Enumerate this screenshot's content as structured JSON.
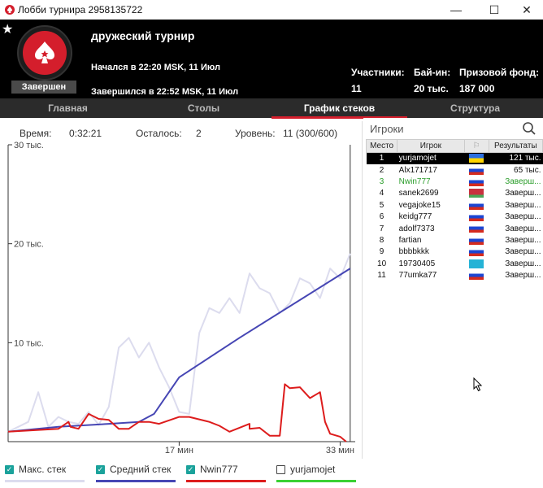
{
  "window": {
    "title": "Лобби турнира 2958135722",
    "minimize": "—",
    "maximize": "☐",
    "close": "✕"
  },
  "header": {
    "tournament_name": "дружеский турнир",
    "status": "Завершен",
    "started": "Начался в 22:20 MSK, 11 Июл",
    "ended": "Завершился в 22:52 MSK, 11 Июл",
    "participants_label": "Участники:",
    "participants_value": "11",
    "buyin_label": "Бай-ин:",
    "buyin_value": "20 тыс.",
    "prize_label": "Призовой фонд:",
    "prize_value": "187 000"
  },
  "tabs": [
    {
      "label": "Главная",
      "active": false
    },
    {
      "label": "Столы",
      "active": false
    },
    {
      "label": "График стеков",
      "active": true
    },
    {
      "label": "Структура",
      "active": false
    }
  ],
  "stats": {
    "time_label": "Время:",
    "time_value": "0:32:21",
    "left_label": "Осталось:",
    "left_value": "2",
    "level_label": "Уровень:",
    "level_value": "11 (300/600)"
  },
  "players": {
    "title": "Игроки",
    "columns": [
      "Место",
      "Игрок",
      "",
      "Результаты"
    ],
    "rows": [
      {
        "place": "1",
        "name": "yurjamojet",
        "flag": "ukraine",
        "result": "121 тыс."
      },
      {
        "place": "2",
        "name": "Alx171717",
        "flag": "russia",
        "result": "65 тыс."
      },
      {
        "place": "3",
        "name": "Nwin777",
        "flag": "russia",
        "result": "Заверш..."
      },
      {
        "place": "4",
        "name": "sanek2699",
        "flag": "belarus",
        "result": "Заверш..."
      },
      {
        "place": "5",
        "name": "vegajoke15",
        "flag": "russia",
        "result": "Заверш..."
      },
      {
        "place": "6",
        "name": "keidg777",
        "flag": "russia",
        "result": "Заверш..."
      },
      {
        "place": "7",
        "name": "adolf7373",
        "flag": "russia",
        "result": "Заверш..."
      },
      {
        "place": "8",
        "name": "fartian",
        "flag": "russia",
        "result": "Заверш..."
      },
      {
        "place": "9",
        "name": "bbbbkkk",
        "flag": "russia",
        "result": "Заверш..."
      },
      {
        "place": "10",
        "name": "19730405",
        "flag": "kazakhstan",
        "result": "Заверш..."
      },
      {
        "place": "11",
        "name": "77umka77",
        "flag": "russia",
        "result": "Заверш..."
      }
    ]
  },
  "chart_data": {
    "type": "line",
    "ytick_labels": [
      "30 тыс.",
      "20 тыс.",
      "10 тыс."
    ],
    "yticks": [
      30000,
      20000,
      10000
    ],
    "ylim": [
      0,
      30000
    ],
    "xtick_labels": [
      "17 мин",
      "33 мин"
    ],
    "xticks": [
      17,
      33
    ],
    "xlim": [
      0,
      34.5
    ],
    "series": [
      {
        "name": "Макс. стек",
        "color": "#dcdcee",
        "checked": true,
        "points": [
          [
            0,
            1000
          ],
          [
            1,
            1500
          ],
          [
            2,
            2000
          ],
          [
            3,
            5000
          ],
          [
            4,
            1500
          ],
          [
            5,
            2500
          ],
          [
            6,
            2000
          ],
          [
            7,
            1800
          ],
          [
            8,
            3000
          ],
          [
            9,
            1700
          ],
          [
            10,
            3500
          ],
          [
            11,
            9500
          ],
          [
            12,
            10500
          ],
          [
            13,
            8500
          ],
          [
            14,
            10000
          ],
          [
            15,
            7500
          ],
          [
            16,
            5500
          ],
          [
            17,
            3000
          ],
          [
            18,
            2800
          ],
          [
            19,
            11000
          ],
          [
            20,
            13500
          ],
          [
            21,
            13000
          ],
          [
            22,
            14500
          ],
          [
            23,
            13000
          ],
          [
            24,
            17000
          ],
          [
            25,
            15500
          ],
          [
            26,
            15000
          ],
          [
            27,
            13000
          ],
          [
            28,
            14000
          ],
          [
            29,
            16500
          ],
          [
            30,
            16000
          ],
          [
            31,
            14500
          ],
          [
            32,
            17500
          ],
          [
            33,
            16500
          ],
          [
            34,
            19000
          ]
        ]
      },
      {
        "name": "Средний стек",
        "color": "#4646b4",
        "checked": true,
        "points": [
          [
            0,
            1000
          ],
          [
            5,
            1500
          ],
          [
            10,
            1800
          ],
          [
            13,
            2000
          ],
          [
            14.5,
            2800
          ],
          [
            17,
            6500
          ],
          [
            23,
            10500
          ],
          [
            34,
            17500
          ]
        ]
      },
      {
        "name": "Nwin777",
        "color": "#dd1c1c",
        "checked": true,
        "points": [
          [
            0,
            1000
          ],
          [
            5,
            1300
          ],
          [
            6,
            2000
          ],
          [
            6.2,
            1500
          ],
          [
            7,
            1300
          ],
          [
            8,
            2800
          ],
          [
            9,
            2300
          ],
          [
            10,
            2200
          ],
          [
            11,
            1300
          ],
          [
            12,
            1300
          ],
          [
            13,
            2000
          ],
          [
            14,
            2000
          ],
          [
            15,
            1800
          ],
          [
            17,
            2500
          ],
          [
            18,
            2500
          ],
          [
            20,
            2000
          ],
          [
            21,
            1600
          ],
          [
            22,
            1000
          ],
          [
            24,
            1800
          ],
          [
            24,
            1300
          ],
          [
            25,
            1400
          ],
          [
            26,
            600
          ],
          [
            27,
            600
          ],
          [
            27.5,
            5800
          ],
          [
            28,
            5400
          ],
          [
            29,
            5500
          ],
          [
            30,
            4400
          ],
          [
            31,
            5000
          ],
          [
            31.5,
            2000
          ],
          [
            32,
            800
          ],
          [
            33,
            500
          ],
          [
            33.6,
            0
          ]
        ]
      },
      {
        "name": "yurjamojet",
        "color": "#3ad134",
        "checked": false,
        "points": []
      }
    ],
    "endline_x": 34,
    "grid": false
  },
  "legend": {
    "items": [
      {
        "label": "Макс. стек",
        "checked": true
      },
      {
        "label": "Средний стек",
        "checked": true
      },
      {
        "label": "Nwin777",
        "checked": true
      },
      {
        "label": "yurjamojet",
        "checked": false
      }
    ]
  }
}
